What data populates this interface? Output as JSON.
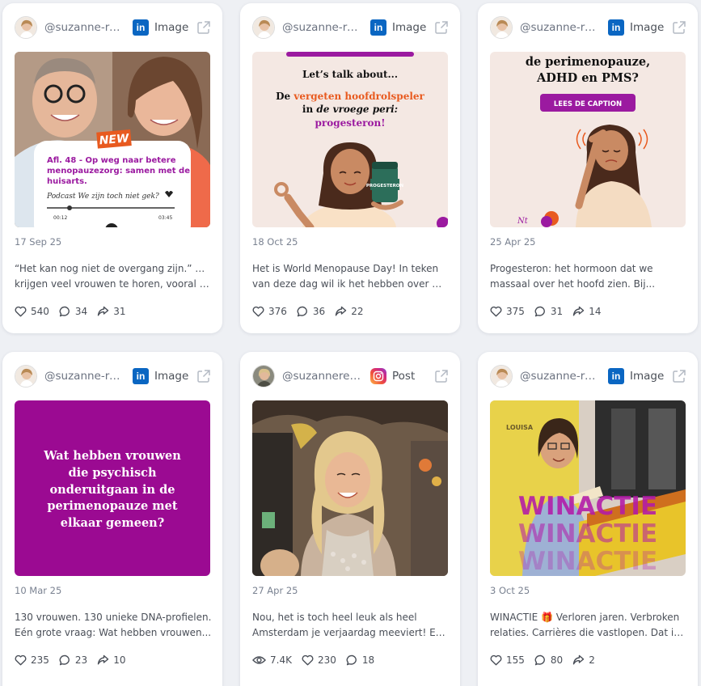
{
  "icons": {
    "external": "external-link-icon",
    "like": "heart-icon",
    "comment": "comment-icon",
    "share": "share-icon",
    "views": "eye-icon"
  },
  "colors": {
    "linkedin": "#0a66c2",
    "purple": "#9b0a92",
    "accent_orange": "#e85a1f"
  },
  "cards": [
    {
      "handle": "@suzanne-ret...",
      "platform": "linkedin",
      "post_type": "Image",
      "date": "17 Sep 25",
      "caption_lines": [
        "“Het kan nog niet de overgang zijn.” Dat",
        "krijgen veel vrouwen te horen, vooral als..."
      ],
      "stats": {
        "likes": "540",
        "comments": "34",
        "shares": "31"
      },
      "media": {
        "badge": "NEW",
        "episode": "Afl. 48 - Op weg naar betere menopauzezorg: samen met de huisarts.",
        "podcast": "Podcast We zijn toch niet gek?",
        "time_start": "00:12",
        "time_end": "03:45"
      }
    },
    {
      "handle": "@suzanne-ret...",
      "platform": "linkedin",
      "post_type": "Image",
      "date": "18 Oct 25",
      "caption_lines": [
        "Het is World Menopause Day! In teken",
        "van deze dag wil ik het hebben over wat..."
      ],
      "stats": {
        "likes": "376",
        "comments": "36",
        "shares": "22"
      },
      "media": {
        "line1": "Let’s talk about...",
        "line2_a": "De ",
        "line2_b": "vergeten hoofdrolspeler",
        "line3_a": "in ",
        "line3_b": "de vroege peri:",
        "line4": "progesteron!",
        "jar_label": "PROGESTERON"
      }
    },
    {
      "handle": "@suzanne-ret...",
      "platform": "linkedin",
      "post_type": "Image",
      "date": "25 Apr 25",
      "caption_lines": [
        "Progesteron: het hormoon dat we",
        "massaal over het hoofd zien. Bij..."
      ],
      "stats": {
        "likes": "375",
        "comments": "31",
        "shares": "14"
      },
      "media": {
        "title1": "de perimenopauze,",
        "title2": "ADHD en PMS?",
        "button": "LEES DE CAPTION",
        "sig": "Nt"
      }
    },
    {
      "handle": "@suzanne-ret...",
      "platform": "linkedin",
      "post_type": "Image",
      "date": "10 Mar 25",
      "caption_lines": [
        "130 vrouwen. 130 unieke DNA-profielen.",
        "Eén grote vraag: Wat hebben vrouwen..."
      ],
      "stats": {
        "likes": "235",
        "comments": "23",
        "shares": "10"
      },
      "media": {
        "lines": [
          "Wat hebben vrouwen",
          "die psychisch",
          "onderuitgaan in de",
          "perimenopauze met",
          "elkaar gemeen?"
        ]
      }
    },
    {
      "handle": "@suzannerethans",
      "platform": "instagram",
      "post_type": "Post",
      "date": "27 Apr 25",
      "caption_lines": [
        "Nou, het is toch heel leuk als heel",
        "Amsterdam je verjaardag meeviert! Een..."
      ],
      "stats": {
        "views": "7.4K",
        "likes": "230",
        "comments": "18"
      }
    },
    {
      "handle": "@suzanne-ret...",
      "platform": "linkedin",
      "post_type": "Image",
      "date": "3 Oct 25",
      "caption_lines": [
        "WINACTIE 🎁 Verloren jaren. Verbroken",
        "relaties. Carrières die vastlopen. Dat is d..."
      ],
      "stats": {
        "likes": "155",
        "comments": "80",
        "shares": "2"
      },
      "media": {
        "overlay": "WINACTIE",
        "book": "LOUISA"
      }
    }
  ]
}
